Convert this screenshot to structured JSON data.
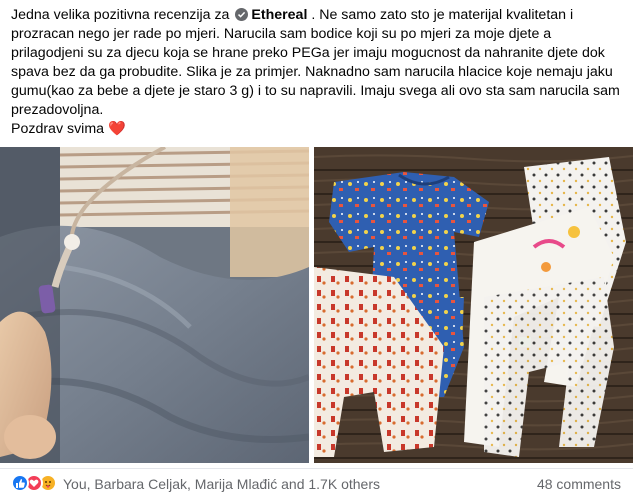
{
  "post": {
    "text_before_tag": "Jedna velika pozitivna recenzija za",
    "tagged_page": "Ethereal",
    "text_line_1_rest": " . Ne samo zato sto je materijal kvalitetan i",
    "text_line_2": "prozracan nego jer rade po mjeri. Narucila sam bodice koji su po mjeri za moje djete a",
    "text_line_3": "prilagodjeni su za djecu koja se hrane preko PEGa jer imaju mogucnost da nahranite djete dok",
    "text_line_4": "spava bez da ga probudite. Slika je za primjer. Naknadno sam narucila hlacice koje nemaju jaku",
    "text_line_5": "gumu(kao za bebe a djete je staro 3 g) i to su napravili. Imaju svega ali ovo sta sam narucila sam",
    "text_line_6": "prezadovoljna.",
    "text_line_7": "Pozdrav svima",
    "heart": "❤️"
  },
  "photos": {
    "left_icon": "photo-feeding-tube",
    "right_icon": "photo-baby-clothes"
  },
  "reactions": {
    "icons": [
      "like-icon",
      "love-icon",
      "care-icon"
    ],
    "names": "You, Barbara Celjak, Marija Mlađić and 1.7K others",
    "comments": "48 comments"
  },
  "colors": {
    "like": "#1877f2",
    "love": "#f33e58",
    "care": "#f7b125",
    "secondary_text": "#65676b"
  }
}
